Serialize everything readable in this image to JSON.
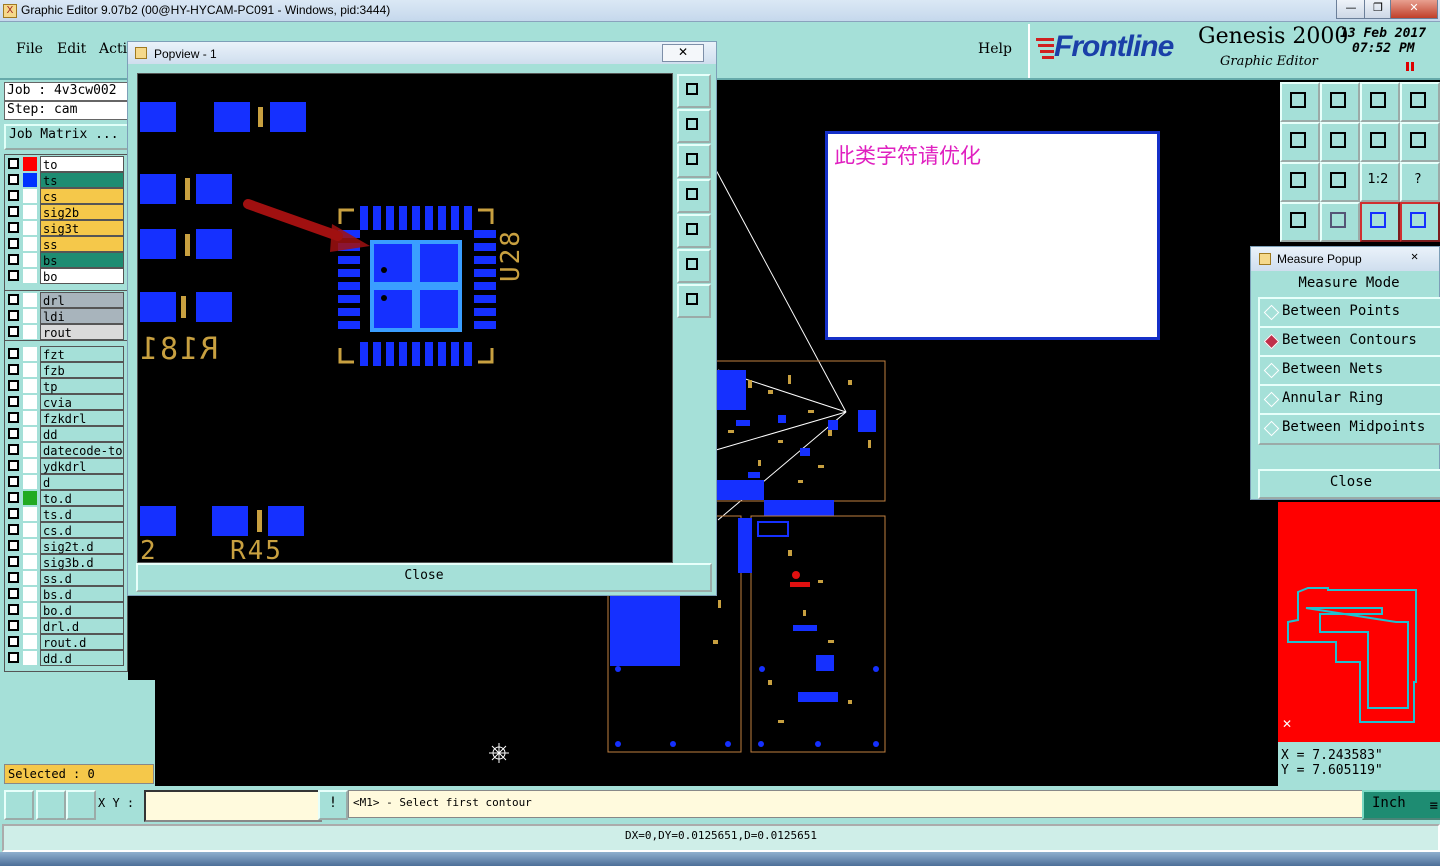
{
  "window": {
    "title": "Graphic Editor 9.07b2 (00@HY-HYCAM-PC091 - Windows, pid:3444)",
    "app_icon": "X"
  },
  "menu": {
    "file": "File",
    "edit": "Edit",
    "action": "Acti",
    "help": "Help"
  },
  "brand": {
    "logo": "Frontline",
    "product": "Genesis 2000",
    "subtitle": "Graphic Editor",
    "date": "13 Feb 2017",
    "time": "07:52 PM"
  },
  "job": {
    "job": "Job  : 4v3cw002",
    "step": "Step: cam",
    "matrix": "Job Matrix ..."
  },
  "layers_board": [
    {
      "name": "to",
      "bg": "#ffffff",
      "color": "#ff0000"
    },
    {
      "name": "ts",
      "bg": "#1e8c72",
      "color": "#0033ff"
    },
    {
      "name": "cs",
      "bg": "#f5c84a",
      "color": "#ffffff"
    },
    {
      "name": "sig2b",
      "bg": "#f5c84a",
      "color": "#ffffff"
    },
    {
      "name": "sig3t",
      "bg": "#f5c84a",
      "color": "#ffffff"
    },
    {
      "name": "ss",
      "bg": "#f5c84a",
      "color": "#ffffff"
    },
    {
      "name": "bs",
      "bg": "#1e8c72",
      "color": "#ffffff"
    },
    {
      "name": "bo",
      "bg": "#ffffff",
      "color": "#ffffff"
    }
  ],
  "layers_drill": [
    {
      "name": "drl",
      "bg": "#a8b4bc"
    },
    {
      "name": "ldi",
      "bg": "#a8b4bc"
    },
    {
      "name": "rout",
      "bg": "#dadada"
    }
  ],
  "layers_misc": [
    {
      "name": "fzt"
    },
    {
      "name": "fzb"
    },
    {
      "name": "tp"
    },
    {
      "name": "cvia"
    },
    {
      "name": "fzkdrl"
    },
    {
      "name": "dd"
    },
    {
      "name": "datecode-to"
    },
    {
      "name": "ydkdrl"
    },
    {
      "name": "d"
    },
    {
      "name": "to.d",
      "color": "#22aa22"
    },
    {
      "name": "ts.d"
    },
    {
      "name": "cs.d"
    },
    {
      "name": "sig2t.d"
    },
    {
      "name": "sig3b.d"
    },
    {
      "name": "ss.d"
    },
    {
      "name": "bs.d"
    },
    {
      "name": "bo.d"
    },
    {
      "name": "drl.d"
    },
    {
      "name": "rout.d"
    },
    {
      "name": "dd.d"
    }
  ],
  "popview": {
    "title": "Popview - 1",
    "close_x": "✕",
    "close": "Close",
    "labels": {
      "r181": "R181",
      "u28": "U28",
      "r45": "R45",
      "n2": "2"
    }
  },
  "annotation": {
    "text": "此类字符请优化"
  },
  "measure": {
    "title": "Measure Popup",
    "mode_label": "Measure Mode",
    "options": [
      {
        "label": "Between Points",
        "selected": false
      },
      {
        "label": "Between Contours",
        "selected": true
      },
      {
        "label": "Between Nets",
        "selected": false
      },
      {
        "label": "Annular Ring",
        "selected": false
      },
      {
        "label": "Between Midpoints",
        "selected": false
      }
    ],
    "close": "Close"
  },
  "right_tools": {
    "ratio": "1:2",
    "help": "?"
  },
  "coords": {
    "x": "X = 7.243583\"",
    "y": "Y = 7.605119\""
  },
  "selected": "Selected : 0",
  "bottom": {
    "xy_label": "X Y :",
    "xy_value": "",
    "warn": "!",
    "prompt": "<M1> - Select first contour",
    "unit": "Inch"
  },
  "status": "DX=0,DY=0.0125651,D=0.0125651"
}
